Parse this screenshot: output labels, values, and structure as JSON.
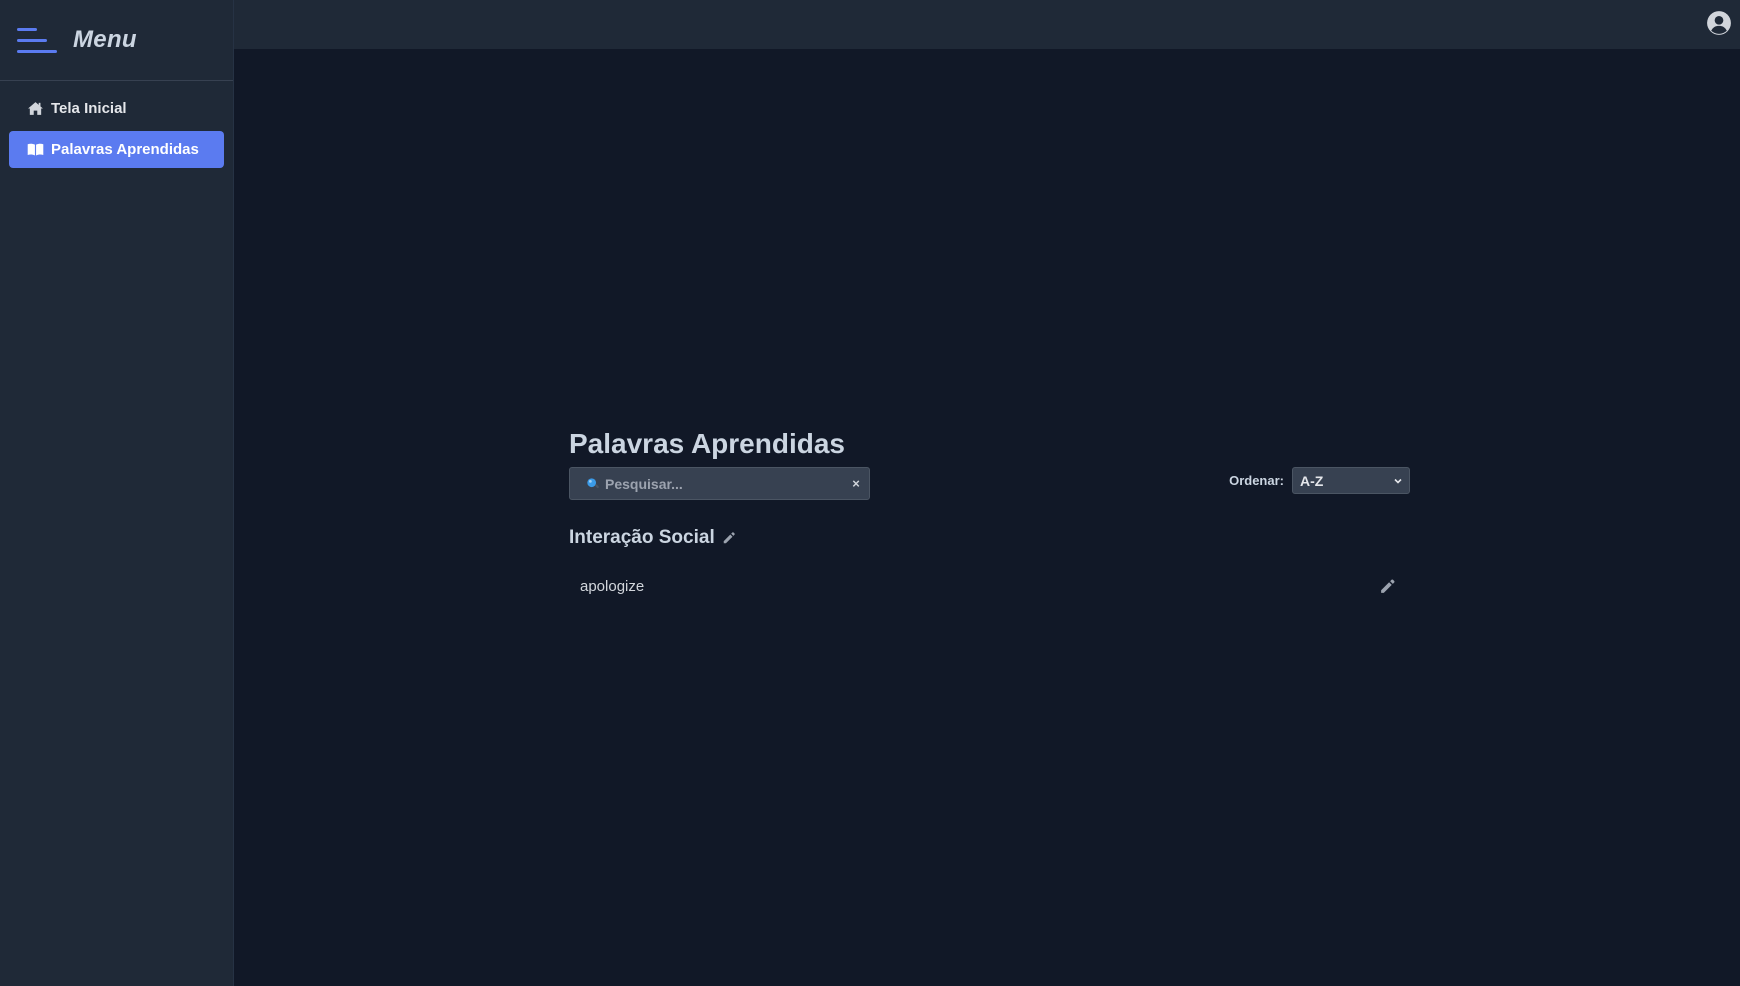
{
  "sidebar": {
    "title": "Menu",
    "items": [
      {
        "label": "Tela Inicial",
        "icon": "home-icon",
        "active": false
      },
      {
        "label": "Palavras Aprendidas",
        "icon": "book-icon",
        "active": true
      }
    ]
  },
  "topbar": {
    "profile_icon": "user-circle-icon"
  },
  "main": {
    "title": "Palavras Aprendidas",
    "search": {
      "placeholder": "Pesquisar...",
      "value": "",
      "clear_label": "×"
    },
    "sort": {
      "label": "Ordenar:",
      "selected": "A-Z"
    },
    "categories": [
      {
        "name": "Interação Social",
        "words": [
          {
            "text": "apologize"
          }
        ]
      }
    ]
  },
  "colors": {
    "accent": "#5b7bf0",
    "background": "#111827",
    "panel": "#1f2937"
  }
}
